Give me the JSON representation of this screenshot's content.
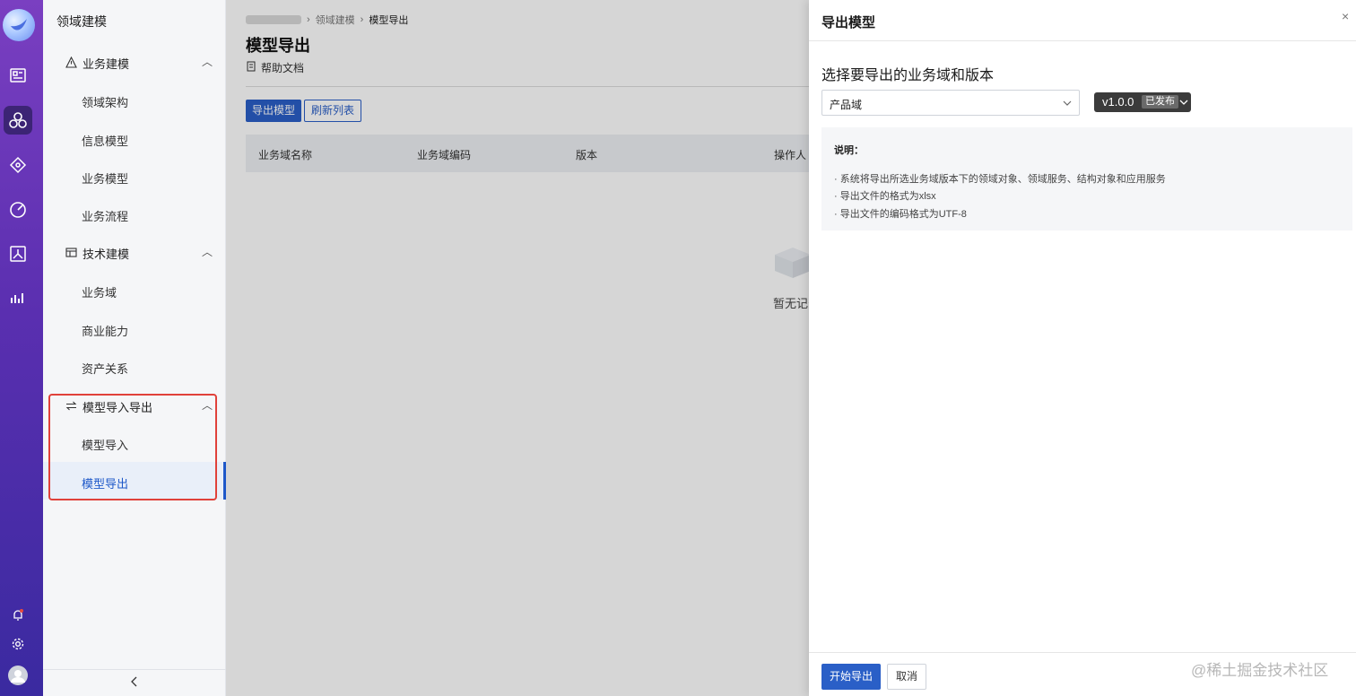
{
  "sidebar": {
    "title": "领域建模",
    "groups": [
      {
        "label": "业务建模",
        "items": [
          "领域架构",
          "信息模型",
          "业务模型",
          "业务流程"
        ]
      },
      {
        "label": "技术建模",
        "items": [
          "业务域",
          "商业能力",
          "资产关系"
        ]
      },
      {
        "label": "模型导入导出",
        "items": [
          "模型导入",
          "模型导出"
        ]
      }
    ],
    "active_item": "模型导出"
  },
  "breadcrumb": {
    "items": [
      "领域建模",
      "模型导出"
    ]
  },
  "page": {
    "title": "模型导出",
    "help_link": "帮助文档",
    "export_button": "导出模型",
    "refresh_button": "刷新列表",
    "table_headers": [
      "业务域名称",
      "业务域编码",
      "版本",
      "操作人"
    ],
    "empty_text": "暂无记录"
  },
  "drawer": {
    "title": "导出模型",
    "close_symbol": "×",
    "section_title": "选择要导出的业务域和版本",
    "domain_select": {
      "value": "产品域"
    },
    "version": {
      "value": "v1.0.0",
      "status": "已发布"
    },
    "note": {
      "heading": "说明：",
      "items": [
        "· 系统将导出所选业务域版本下的领域对象、领域服务、结构对象和应用服务",
        "· 导出文件的格式为xlsx",
        "· 导出文件的编码格式为UTF-8"
      ]
    },
    "start_button": "开始导出",
    "cancel_button": "取消"
  },
  "watermark": "@稀土掘金技术社区",
  "colors": {
    "primary": "#2a5fc7",
    "highlight": "#e0413a",
    "rail_top": "#7a3fc1",
    "rail_bottom": "#3a2aa0"
  }
}
